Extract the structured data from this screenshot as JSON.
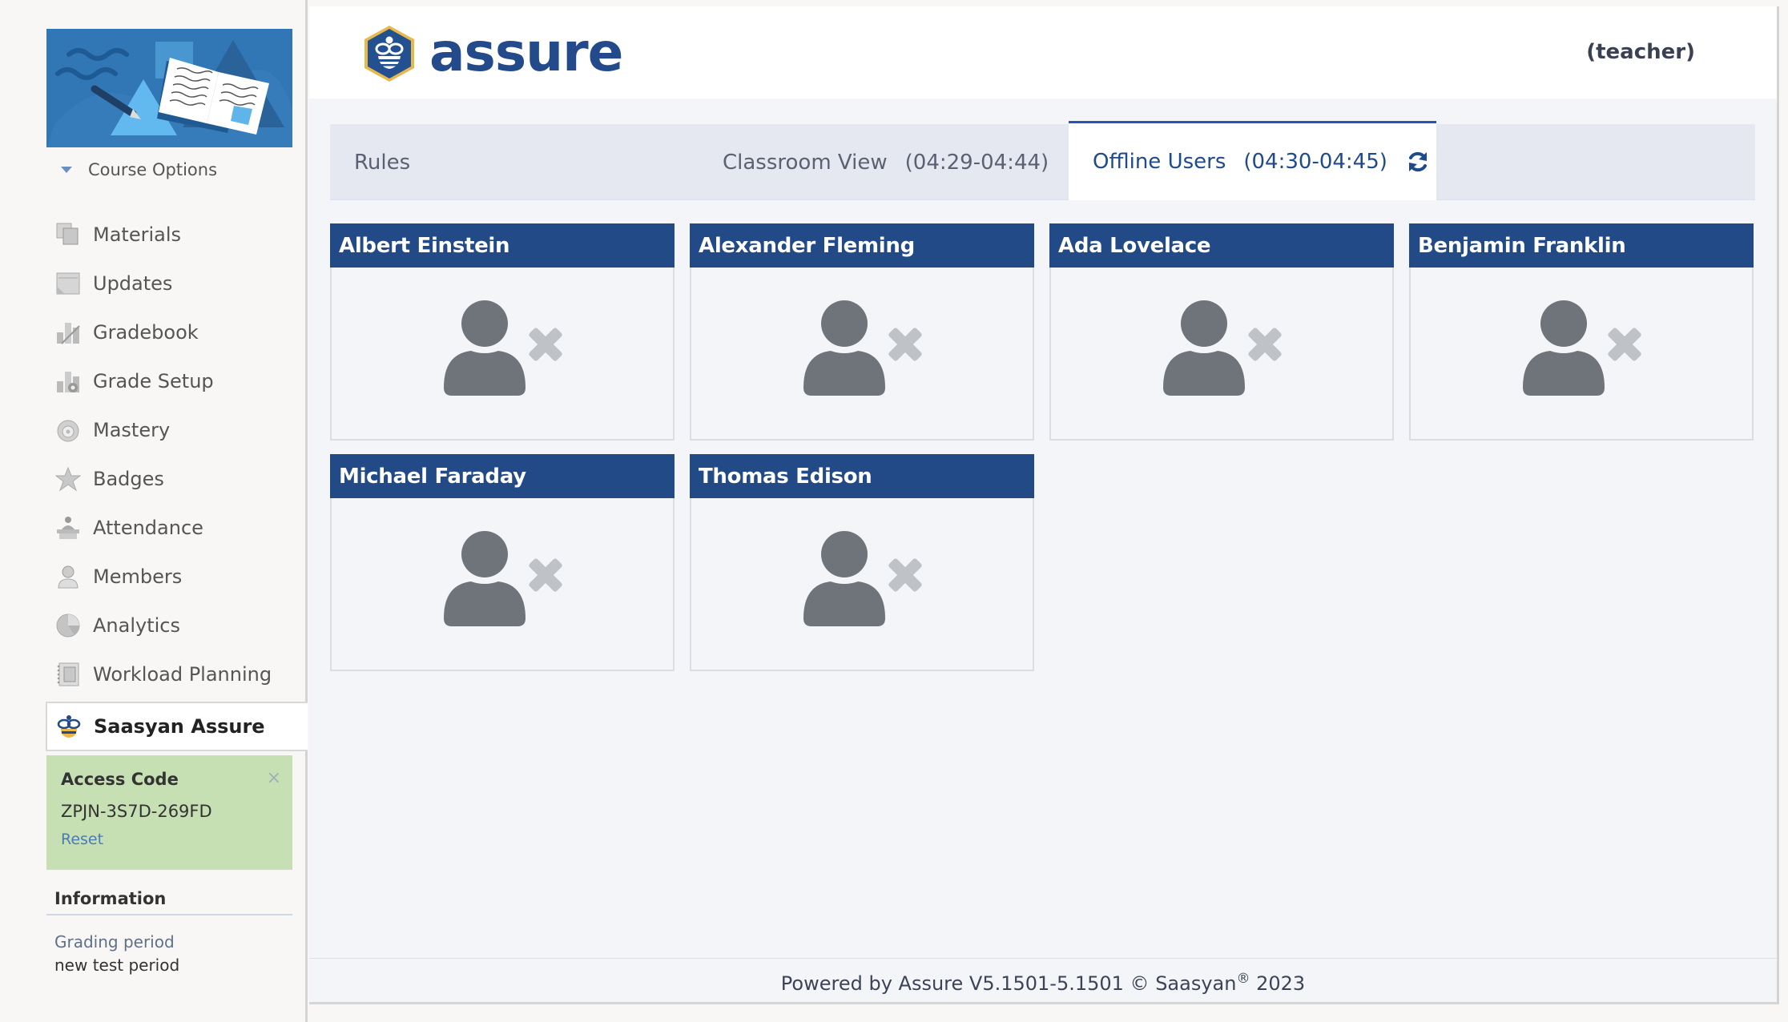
{
  "sidebar": {
    "banner_alt": "course banner",
    "course_options_label": "Course Options",
    "nav_items": [
      {
        "label": "Materials",
        "icon": "materials-icon"
      },
      {
        "label": "Updates",
        "icon": "updates-icon"
      },
      {
        "label": "Gradebook",
        "icon": "gradebook-icon"
      },
      {
        "label": "Grade Setup",
        "icon": "grade-setup-icon"
      },
      {
        "label": "Mastery",
        "icon": "mastery-icon"
      },
      {
        "label": "Badges",
        "icon": "badge-star-icon"
      },
      {
        "label": "Attendance",
        "icon": "attendance-icon"
      },
      {
        "label": "Members",
        "icon": "members-icon"
      },
      {
        "label": "Analytics",
        "icon": "analytics-pie-icon"
      },
      {
        "label": "Workload Planning",
        "icon": "workload-planning-icon"
      }
    ],
    "active_item": {
      "label": "Saasyan Assure",
      "icon": "bee-icon"
    },
    "access_code": {
      "title": "Access Code",
      "code": "ZPJN-3S7D-269FD",
      "reset_label": "Reset",
      "close_glyph": "×"
    },
    "information": {
      "title": "Information",
      "grading_period_label": "Grading period",
      "grading_period_value": "new test period"
    }
  },
  "header": {
    "logo_text": "assure",
    "role": "(teacher)"
  },
  "tabs": [
    {
      "label": "Rules",
      "time": ""
    },
    {
      "label": "Classroom View",
      "time": "(04:29-04:44)"
    },
    {
      "label": "Offline Users",
      "time": "(04:30-04:45)",
      "active": true
    }
  ],
  "offline_users": [
    {
      "name": "Albert Einstein",
      "status_icon": "user-offline-icon"
    },
    {
      "name": "Alexander Fleming",
      "status_icon": "user-offline-icon"
    },
    {
      "name": "Ada Lovelace",
      "status_icon": "user-offline-icon"
    },
    {
      "name": "Benjamin Franklin",
      "status_icon": "user-offline-icon"
    },
    {
      "name": "Michael Faraday",
      "status_icon": "user-offline-icon"
    },
    {
      "name": "Thomas Edison",
      "status_icon": "user-offline-icon"
    }
  ],
  "footer": {
    "text_before": "Powered by Assure V5.1501-5.1501 © Saasyan",
    "registered": "®",
    "text_after": " 2023"
  },
  "colors": {
    "brand_navy": "#224a86",
    "active_tab_border": "#2456b8",
    "access_box_bg": "#c6e0b4",
    "logo_gold": "#e8b84a",
    "user_icon_gray": "#6f747b",
    "x_icon_gray": "#bfc2c7"
  }
}
